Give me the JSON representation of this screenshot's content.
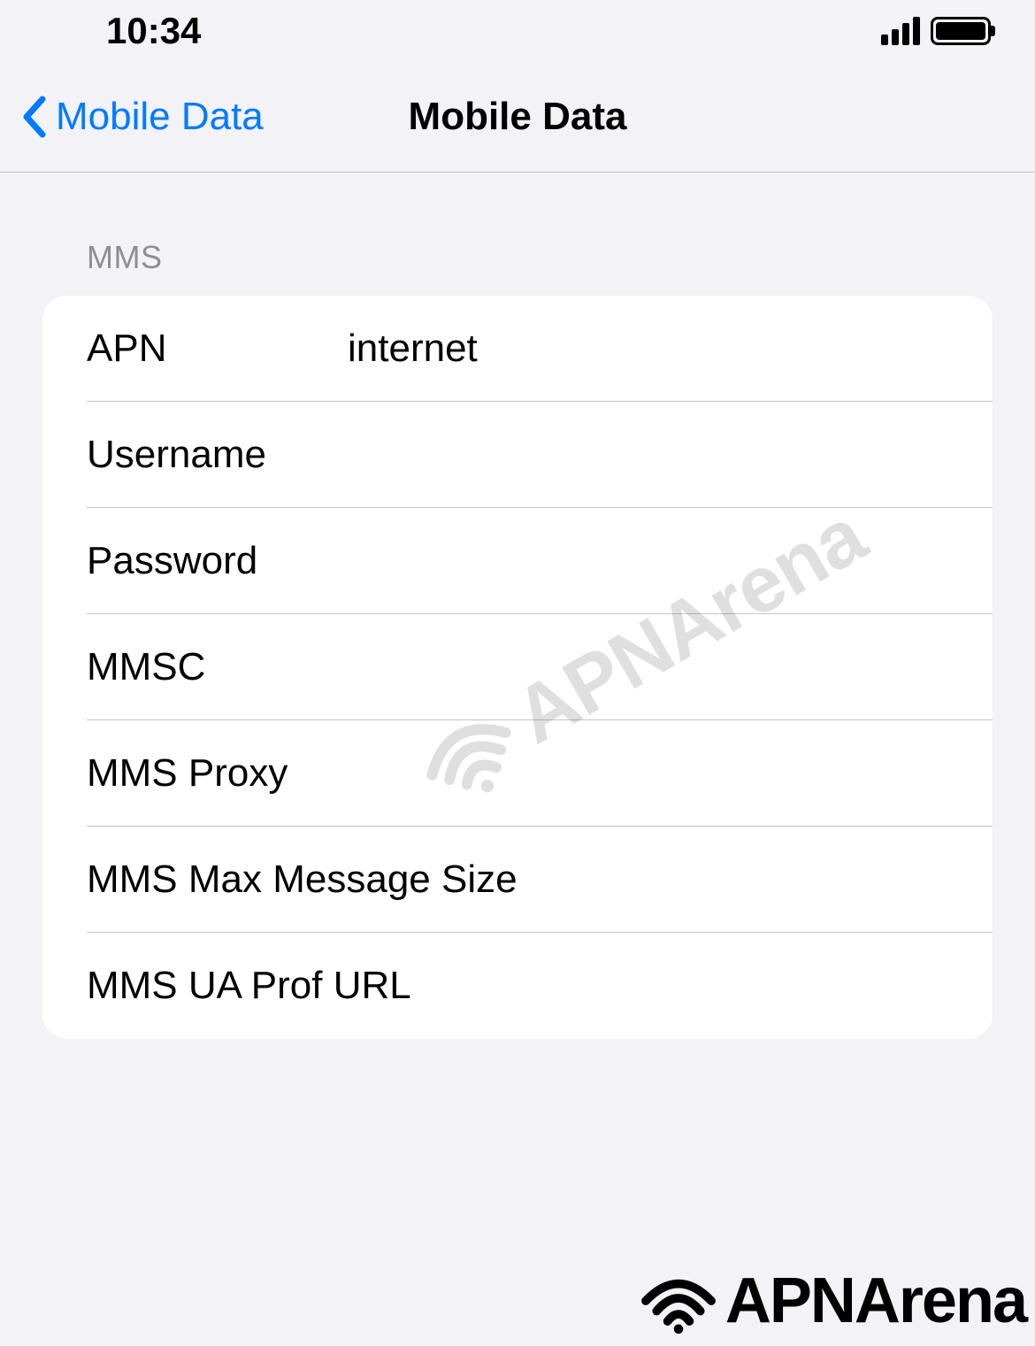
{
  "status": {
    "time": "10:34"
  },
  "nav": {
    "back_label": "Mobile Data",
    "title": "Mobile Data"
  },
  "section": {
    "header": "MMS"
  },
  "fields": {
    "apn": {
      "label": "APN",
      "value": "internet"
    },
    "username": {
      "label": "Username",
      "value": ""
    },
    "password": {
      "label": "Password",
      "value": ""
    },
    "mmsc": {
      "label": "MMSC",
      "value": ""
    },
    "mms_proxy": {
      "label": "MMS Proxy",
      "value": ""
    },
    "mms_max_size": {
      "label": "MMS Max Message Size",
      "value": ""
    },
    "mms_ua_prof": {
      "label": "MMS UA Prof URL",
      "value": ""
    }
  },
  "watermark": {
    "text": "APNArena"
  }
}
